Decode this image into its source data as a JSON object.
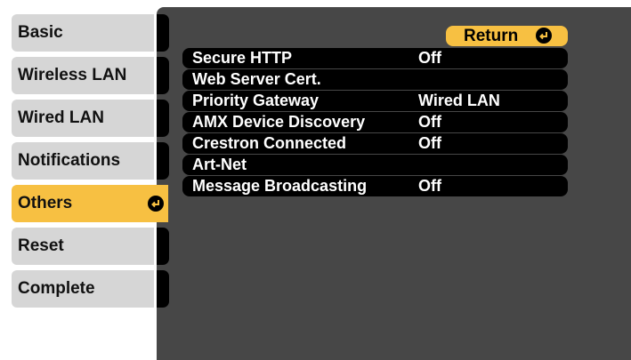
{
  "sidebar": {
    "items": [
      {
        "label": "Basic"
      },
      {
        "label": "Wireless LAN"
      },
      {
        "label": "Wired LAN"
      },
      {
        "label": "Notifications"
      },
      {
        "label": "Others",
        "active": true
      },
      {
        "label": "Reset"
      },
      {
        "label": "Complete"
      }
    ]
  },
  "return_button": {
    "label": "Return",
    "icon": "enter-icon"
  },
  "menu": {
    "rows": [
      {
        "label": "Secure HTTP",
        "value": "Off"
      },
      {
        "label": "Web Server Cert.",
        "value": ""
      },
      {
        "label": "Priority Gateway",
        "value": "Wired LAN"
      },
      {
        "label": "AMX Device Discovery",
        "value": "Off"
      },
      {
        "label": "Crestron Connected",
        "value": "Off"
      },
      {
        "label": "Art-Net",
        "value": ""
      },
      {
        "label": "Message Broadcasting",
        "value": "Off"
      }
    ]
  },
  "colors": {
    "accent": "#f7c042",
    "tab_inactive": "#d6d6d6",
    "panel": "#474747",
    "row": "#000000"
  }
}
